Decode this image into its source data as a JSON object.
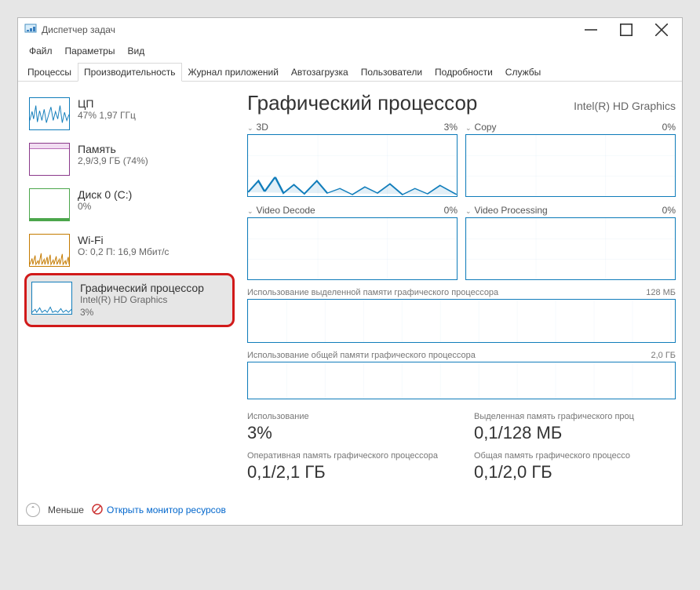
{
  "window": {
    "title": "Диспетчер задач"
  },
  "menu": {
    "file": "Файл",
    "options": "Параметры",
    "view": "Вид"
  },
  "tabs": {
    "processes": "Процессы",
    "performance": "Производительность",
    "app_history": "Журнал приложений",
    "startup": "Автозагрузка",
    "users": "Пользователи",
    "details": "Подробности",
    "services": "Службы"
  },
  "sidebar": {
    "cpu": {
      "title": "ЦП",
      "sub": "47%  1,97 ГГц"
    },
    "memory": {
      "title": "Память",
      "sub": "2,9/3,9 ГБ (74%)"
    },
    "disk": {
      "title": "Диск 0 (C:)",
      "sub": "0%"
    },
    "wifi": {
      "title": "Wi-Fi",
      "sub": "О: 0,2  П: 16,9 Мбит/с"
    },
    "gpu": {
      "title": "Графический процессор",
      "sub1": "Intel(R) HD Graphics",
      "sub2": "3%"
    }
  },
  "main": {
    "title": "Графический процессор",
    "device": "Intel(R) HD Graphics",
    "panels": {
      "p3d": {
        "label": "3D",
        "value": "3%"
      },
      "copy": {
        "label": "Copy",
        "value": "0%"
      },
      "decode": {
        "label": "Video Decode",
        "value": "0%"
      },
      "processing": {
        "label": "Video Processing",
        "value": "0%"
      }
    },
    "dedicated": {
      "label": "Использование выделенной памяти графического процессора",
      "value": "128 МБ"
    },
    "shared": {
      "label": "Использование общей памяти графического процессора",
      "value": "2,0 ГБ"
    },
    "stats": {
      "usage_label": "Использование",
      "usage_value": "3%",
      "dedicated_label": "Выделенная память графического проц",
      "dedicated_value": "0,1/128 МБ",
      "ram_label": "Оперативная память графического процессора",
      "ram_value": "0,1/2,1 ГБ",
      "shared_label": "Общая память графического процессо",
      "shared_value": "0,1/2,0 ГБ"
    }
  },
  "footer": {
    "less": "Меньше",
    "resource_monitor": "Открыть монитор ресурсов"
  }
}
